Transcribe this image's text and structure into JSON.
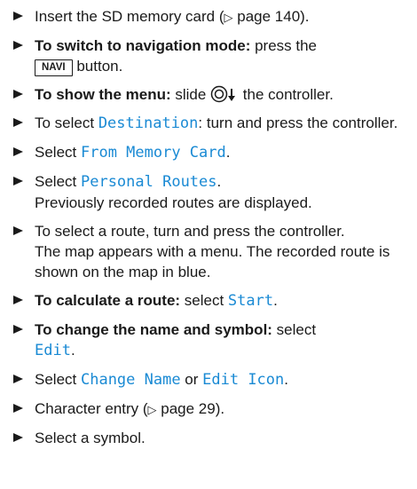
{
  "steps": {
    "s1": {
      "a": "Insert the SD memory card (",
      "ref": "▷",
      "b": " page 140)."
    },
    "s2": {
      "bold": "To switch to navigation mode:",
      "a": " press the",
      "key": "NAVI",
      "b": " button."
    },
    "s3": {
      "bold": "To show the menu:",
      "a": " slide ",
      "b": " the controller."
    },
    "s4": {
      "a": "To select ",
      "m1": "Destination",
      "b": ": turn and press the controller."
    },
    "s5": {
      "a": "Select ",
      "m1": "From Memory Card",
      "b": "."
    },
    "s6": {
      "a": "Select ",
      "m1": "Personal Routes",
      "b": ".",
      "result": "Previously recorded routes are displayed."
    },
    "s7": {
      "a": "To select a route, turn and press the controller.",
      "result": "The map appears with a menu. The recorded route is shown on the map in blue."
    },
    "s8": {
      "bold": "To calculate a route:",
      "a": " select ",
      "m1": "Start",
      "b": "."
    },
    "s9": {
      "bold": "To change the name and symbol:",
      "a": " select",
      "m1": "Edit",
      "b": "."
    },
    "s10": {
      "a": "Select ",
      "m1": "Change Name",
      "or": " or ",
      "m2": "Edit Icon",
      "b": "."
    },
    "s11": {
      "a": "Character entry (",
      "ref": "▷",
      "b": " page 29)."
    },
    "s12": {
      "a": "Select a symbol."
    }
  }
}
